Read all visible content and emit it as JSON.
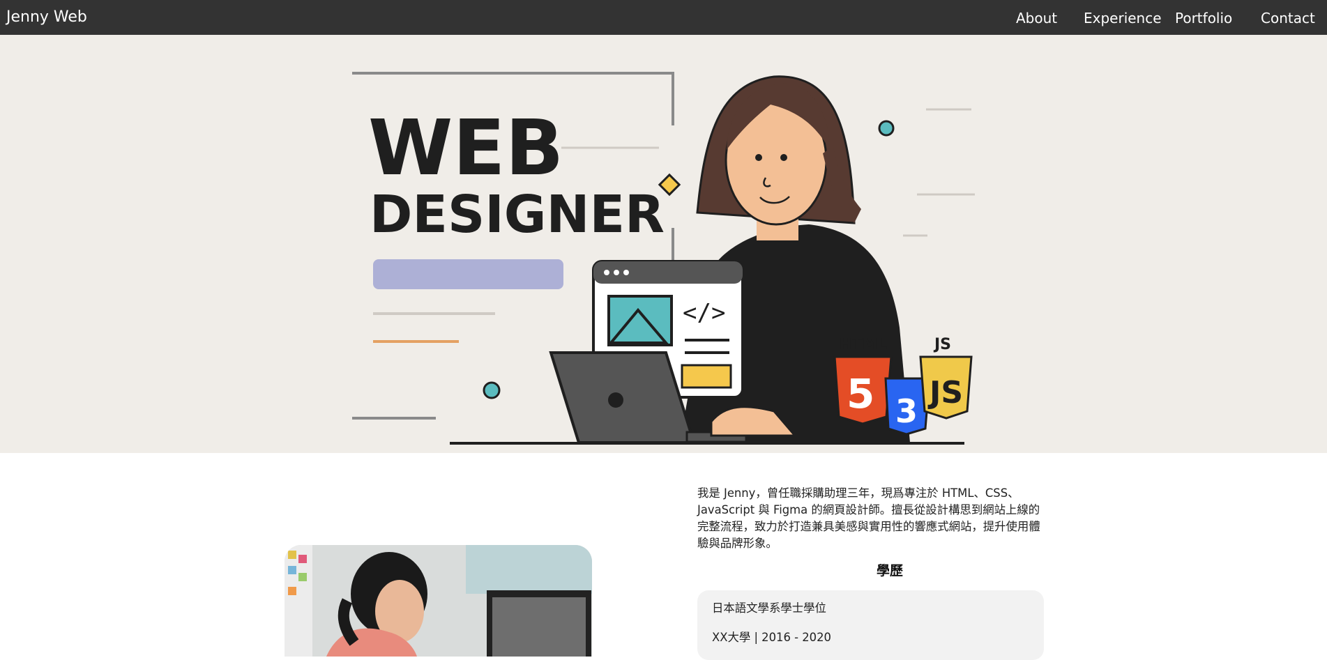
{
  "nav": {
    "brand": "Jenny Web",
    "links": [
      "About",
      "Experience",
      "Portfolio",
      "Contact"
    ]
  },
  "hero": {
    "title_line1": "WEB",
    "title_line2": "DESIGNER",
    "badges": {
      "html": "HTML",
      "js": "JS"
    },
    "colors": {
      "background": "#f0ede8",
      "accent_teal": "#5bbcbf",
      "accent_purple": "#adb0d6",
      "accent_orange": "#e4a163",
      "html_orange": "#e44d26",
      "css_blue": "#2965f1",
      "js_yellow": "#f0c94a"
    }
  },
  "about": {
    "intro_lines": [
      "我是 Jenny，曾任職採購助理三年，現爲專注於 HTML、CSS、",
      "JavaScript 與 Figma 的網頁設計師。擅長從設計構思到網站上線的",
      "完整流程，致力於打造兼具美感與實用性的響應式網站，提升使用體",
      "驗與品牌形象。"
    ],
    "education_title": "學歷",
    "education": {
      "degree": "日本語文學系學士學位",
      "school": "XX大學 | 2016 - 2020"
    }
  },
  "colors": {
    "navbar": "#333333",
    "text": "#222222"
  }
}
